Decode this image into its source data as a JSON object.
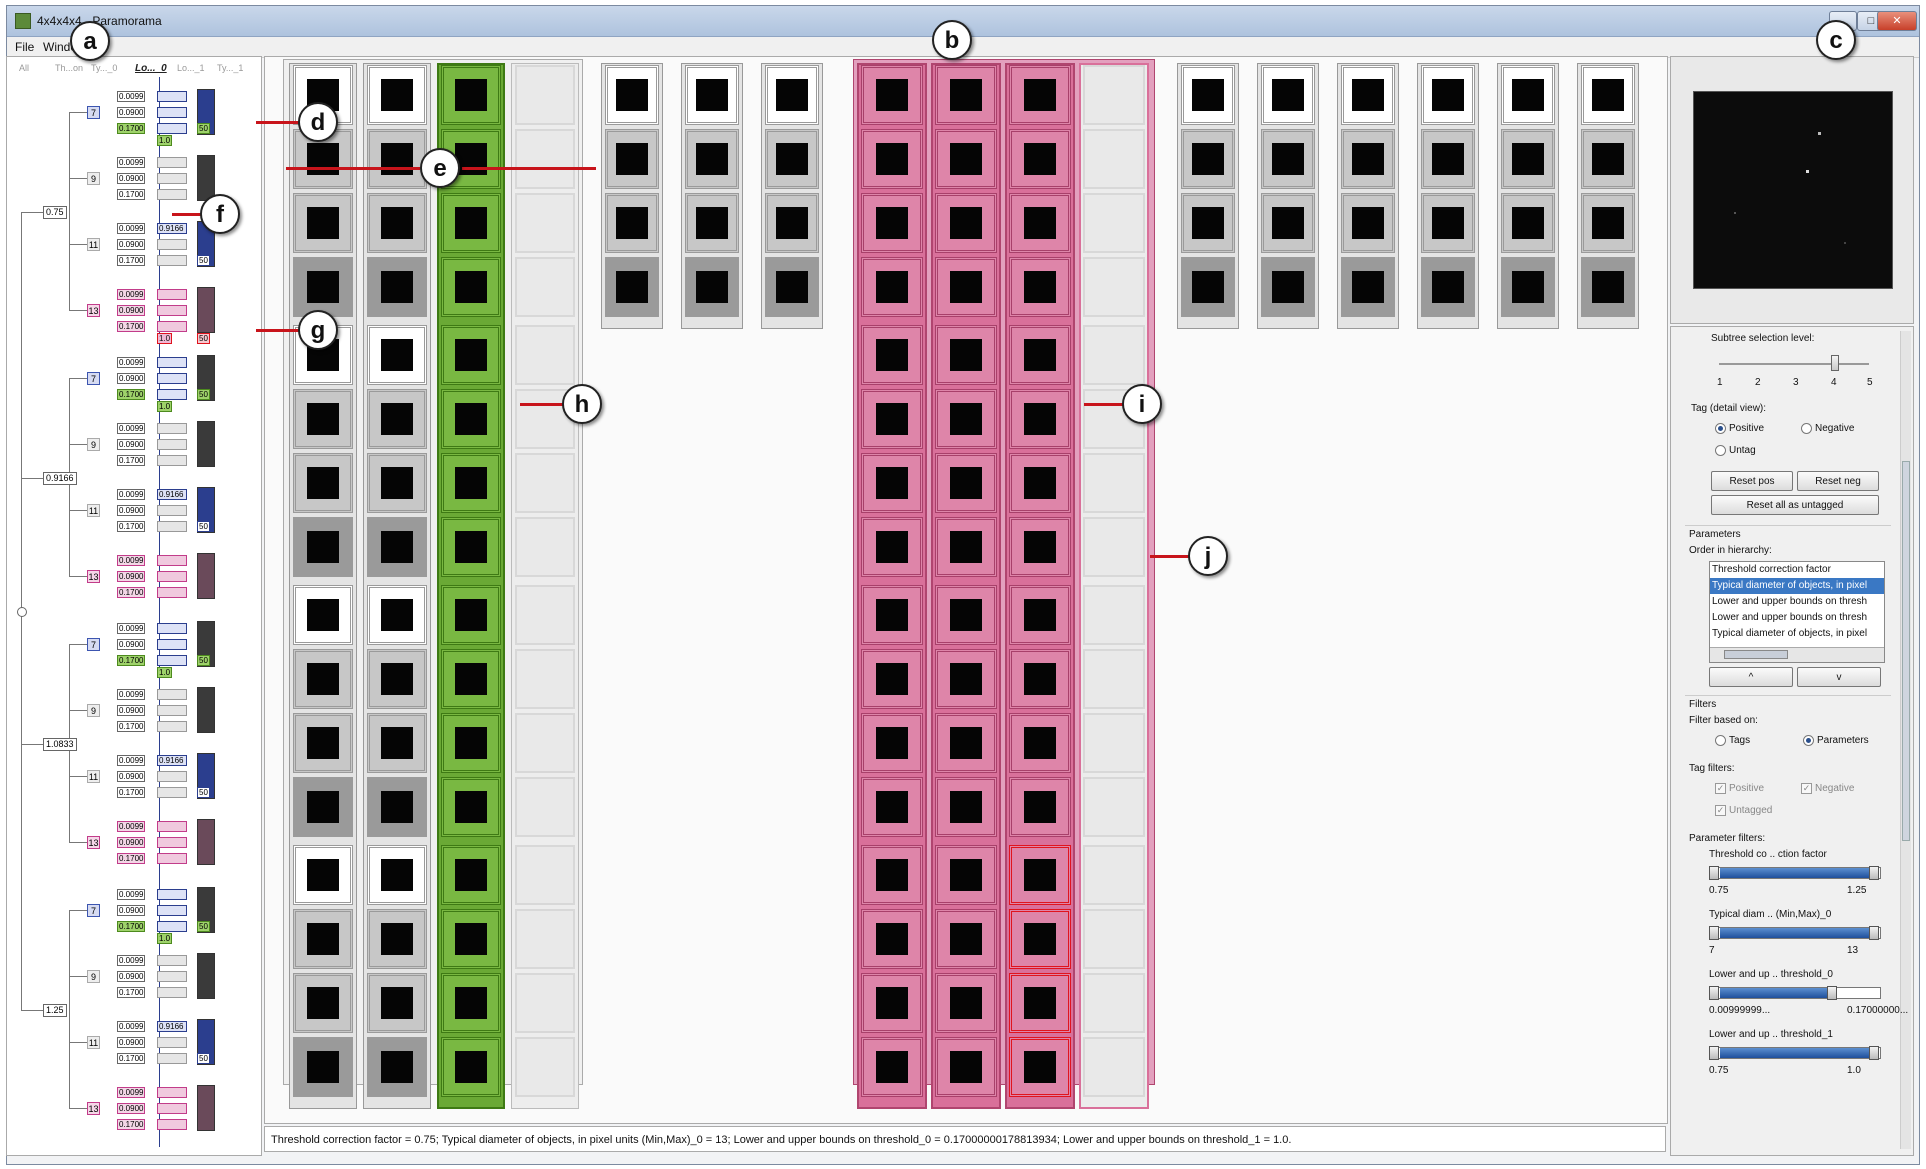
{
  "window": {
    "title": "4x4x4x4 - Paramorama",
    "buttons": {
      "minimize": "_",
      "maximize": "□",
      "close": "✕"
    }
  },
  "menu": [
    "File",
    "Window"
  ],
  "tree": {
    "headers": [
      "All",
      "Th...on",
      "Ty..._0",
      "Lo..._0",
      "Lo..._1",
      "Ty..._1"
    ],
    "threshold_nodes": [
      "0.75",
      "0.9166",
      "1.0833",
      "1.25"
    ],
    "diameter_nodes": [
      "7",
      "9",
      "11",
      "13"
    ],
    "bound_values": [
      "0.0099",
      "0.0900",
      "0.1700"
    ],
    "selected_value": "0.9166",
    "leaf_badge": "1.0",
    "count_badge": "50"
  },
  "status": "Threshold correction factor = 0.75; Typical diameter of objects, in pixel units (Min,Max)_0 = 13; Lower and upper bounds on threshold_0 = 0.17000000178813934; Lower and upper bounds on threshold_1 = 1.0.",
  "controls": {
    "subtree": {
      "label": "Subtree selection level:",
      "ticks": [
        "1",
        "2",
        "3",
        "4",
        "5"
      ],
      "value": 4
    },
    "tag": {
      "label": "Tag (detail view):",
      "options": [
        "Positive",
        "Negative",
        "Untag"
      ],
      "selected": "Positive",
      "reset_pos": "Reset pos",
      "reset_neg": "Reset neg",
      "reset_all": "Reset all as untagged"
    },
    "parameters": {
      "section": "Parameters",
      "order_label": "Order in hierarchy:",
      "items": [
        "Threshold correction factor",
        "Typical diameter of objects, in pixel",
        "Lower and upper bounds on thresh",
        "Lower and upper bounds on thresh",
        "Typical diameter of objects, in pixel"
      ],
      "selected_index": 1,
      "up": "^",
      "down": "v"
    },
    "filters": {
      "section": "Filters",
      "based_on_label": "Filter based on:",
      "based_options": [
        "Tags",
        "Parameters"
      ],
      "based_selected": "Parameters",
      "tag_filters_label": "Tag filters:",
      "tag_filters": [
        "Positive",
        "Negative",
        "Untagged"
      ],
      "param_filters_label": "Parameter filters:",
      "param_filters": [
        {
          "name": "Threshold co .. ction factor",
          "min": "0.75",
          "max": "1.25",
          "fill": 1.0
        },
        {
          "name": "Typical diam ..  (Min,Max)_0",
          "min": "7",
          "max": "13",
          "fill": 1.0
        },
        {
          "name": "Lower and up ..  threshold_0",
          "min": "0.00999999...",
          "max": "0.17000000...",
          "fill": 0.72
        },
        {
          "name": "Lower and up ..  threshold_1",
          "min": "0.75",
          "max": "1.0",
          "fill": 1.0
        }
      ]
    }
  },
  "callouts": [
    "a",
    "b",
    "c",
    "d",
    "e",
    "f",
    "g",
    "h",
    "i",
    "j"
  ],
  "colors": {
    "positive": "#5a9a2c",
    "negative": "#d9709a",
    "selection": "#2b3e8e",
    "highlight": "#e0141e",
    "arrow": "#c8141b"
  }
}
